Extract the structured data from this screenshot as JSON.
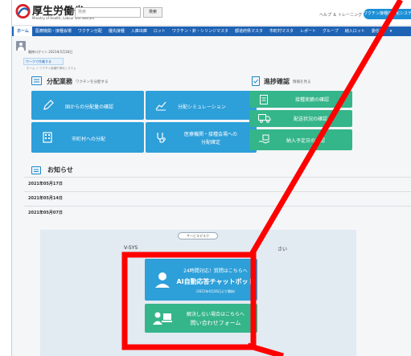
{
  "header": {
    "logo_text": "厚生労働省",
    "logo_sub": "Ministry of Health, Labour and Welfare",
    "search_placeholder": "検索",
    "search_button": "検索",
    "help_link": "ヘルプ ＆ トレーニング",
    "vaccine_button": "ワクチン接種円滑化システム"
  },
  "nav": {
    "items": [
      "ホーム",
      "医療機関・接種会場",
      "ワクチン分配",
      "優先接種",
      "入庫出庫",
      "ロット",
      "ワクチン・針・シリンジマスタ",
      "都道府県マスタ",
      "市町村マスタ",
      "レポート",
      "グループ",
      "納入ロット",
      "委任状",
      "▾"
    ]
  },
  "user": {
    "date": "最終ログイン 2021年5月18日"
  },
  "tab_chip": "ワークで作業する",
  "breadcrumb": "ホーム ＞ ワクチン接種円滑化システム",
  "distribution": {
    "title": "分配業務",
    "subtitle": "ワクチンを分配する",
    "tiles": [
      {
        "label": "国からの分配量の確認"
      },
      {
        "label": "分配シミュレーション"
      },
      {
        "label": "市町村への分配"
      },
      {
        "label": "医療機関・接種会場への",
        "label2": "分配確定"
      }
    ]
  },
  "progress": {
    "title": "進捗確認",
    "subtitle": "情報を見る",
    "tiles": [
      {
        "label": "接種実績の確認"
      },
      {
        "label": "配送状況の確認"
      },
      {
        "label": "納入予定日の確認"
      }
    ]
  },
  "notices": {
    "title": "お知らせ",
    "items": [
      "2021年05月17日",
      "2021年05月14日",
      "2021年05月07日"
    ]
  },
  "support": {
    "badge": "サービスデスク",
    "text_left": "V-SYS",
    "text_right": "さい",
    "chat": {
      "line1": "24時間対応！質問はこちらへ",
      "line2": "AI自動応答チャットボット",
      "line3": "（2021年4月26日より開始）"
    },
    "form": {
      "line1": "解決しない場合はこちらへ",
      "line2": "問い合わせフォーム"
    }
  },
  "colors": {
    "nav": "#1f63b4",
    "tile_blue": "#2d9fd9",
    "tile_green": "#35b58a",
    "highlight": "#ff0000"
  }
}
